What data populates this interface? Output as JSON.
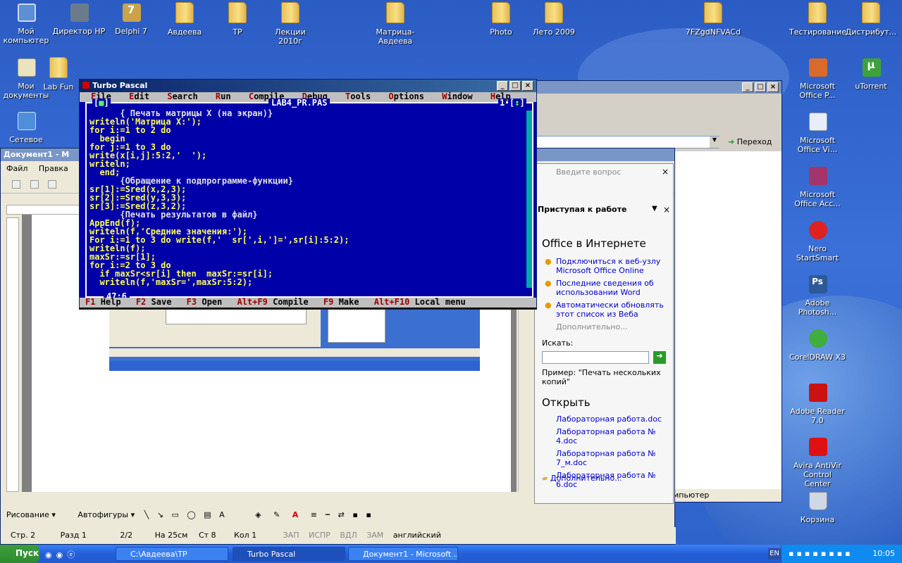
{
  "desktop_icons": [
    {
      "label": "Мой компьютер",
      "icon": "my-computer-icon"
    },
    {
      "label": "Директор HP",
      "icon": "hp-director-icon"
    },
    {
      "label": "Delphi 7",
      "icon": "delphi-icon"
    },
    {
      "label": "Авдеева",
      "icon": "folder-icon"
    },
    {
      "label": "TP",
      "icon": "folder-icon"
    },
    {
      "label": "Лекции 2010г",
      "icon": "folder-icon"
    },
    {
      "label": "Матрица-Авдеева",
      "icon": "folder-icon"
    },
    {
      "label": "Photo",
      "icon": "folder-icon"
    },
    {
      "label": "Лето 2009",
      "icon": "folder-icon"
    },
    {
      "label": "7FZgdNFVACd",
      "icon": "folder-icon"
    },
    {
      "label": "Тестирование",
      "icon": "folder-icon"
    },
    {
      "label": "Дистрибут...",
      "icon": "folder-icon"
    },
    {
      "label": "Мои документы",
      "icon": "my-documents-icon"
    },
    {
      "label": "Lab Fun",
      "icon": "folder-icon"
    },
    {
      "label": "Сетевое",
      "icon": "network-icon"
    },
    {
      "label": "Microsoft Office P...",
      "icon": "powerpoint-icon"
    },
    {
      "label": "uTorrent",
      "icon": "utorrent-icon"
    },
    {
      "label": "Microsoft Office Vi...",
      "icon": "visio-icon"
    },
    {
      "label": "Microsoft Office Acc...",
      "icon": "access-icon"
    },
    {
      "label": "Nero StartSmart",
      "icon": "nero-icon"
    },
    {
      "label": "Adobe Photosh...",
      "icon": "photoshop-icon"
    },
    {
      "label": "CorelDRAW X3",
      "icon": "coreldraw-icon"
    },
    {
      "label": "Adobe Reader 7.0",
      "icon": "adobe-reader-icon"
    },
    {
      "label": "Avira AntiVir Control Center",
      "icon": "avira-icon"
    },
    {
      "label": "Корзина",
      "icon": "recycle-bin-icon"
    }
  ],
  "tp": {
    "title": "Turbo Pascal",
    "menu": [
      {
        "hot": "F",
        "rest": "ile"
      },
      {
        "hot": "E",
        "rest": "dit"
      },
      {
        "hot": "S",
        "rest": "earch"
      },
      {
        "hot": "R",
        "rest": "un"
      },
      {
        "hot": "C",
        "rest": "ompile"
      },
      {
        "hot": "D",
        "rest": "ebug"
      },
      {
        "hot": "T",
        "rest": "ools"
      },
      {
        "hot": "O",
        "rest": "ptions"
      },
      {
        "hot": "W",
        "rest": "indow"
      },
      {
        "hot": "H",
        "rest": "elp"
      }
    ],
    "file_name": "LAB4_PR.PAS",
    "window_number": "1",
    "cursor_pos": "47:6",
    "code_lines": [
      {
        "t": "      { Печать матрицы X (на экран)}",
        "c": true
      },
      {
        "t": "writeln('Матрица X:');",
        "c": false
      },
      {
        "t": "for i:=1 to 2 do",
        "c": false
      },
      {
        "t": "  begin",
        "c": false
      },
      {
        "t": "for j:=1 to 3 do",
        "c": false
      },
      {
        "t": "write(x[i,j]:5:2,'  ');",
        "c": false
      },
      {
        "t": "writeln;",
        "c": false
      },
      {
        "t": "  end;",
        "c": false
      },
      {
        "t": "      {Обращение к подпрограмме-функции}",
        "c": true
      },
      {
        "t": "sr[1]:=Sred(x,2,3);",
        "c": false
      },
      {
        "t": "sr[2]:=Sred(y,3,3);",
        "c": false
      },
      {
        "t": "sr[3]:=Sred(z,3,2);",
        "c": false
      },
      {
        "t": "      {Печать результатов в файл}",
        "c": true
      },
      {
        "t": "AppEnd(f);",
        "c": false
      },
      {
        "t": "writeln(f,'Средние значения:');",
        "c": false
      },
      {
        "t": "For i:=1 to 3 do write(f,'  sr[',i,']=',sr[i]:5:2);",
        "c": false
      },
      {
        "t": "writeln(f);",
        "c": false
      },
      {
        "t": "maxSr:=sr[1];",
        "c": false
      },
      {
        "t": "for i:=2 to 3 do",
        "c": false
      },
      {
        "t": "  if maxSr<sr[i] then  maxSr:=sr[i];",
        "c": false
      },
      {
        "t": "  writeln(f,'maxSr=',maxSr:5:2);",
        "c": false
      }
    ],
    "status": [
      {
        "key": "F1",
        "label": "Help"
      },
      {
        "key": "F2",
        "label": "Save"
      },
      {
        "key": "F3",
        "label": "Open"
      },
      {
        "key": "Alt+F9",
        "label": "Compile"
      },
      {
        "key": "F9",
        "label": "Make"
      },
      {
        "key": "Alt+F10",
        "label": "Local menu"
      }
    ]
  },
  "explorer": {
    "go_label": "Переход",
    "status_fragment": "мпьютер"
  },
  "word": {
    "title": "Документ1 - М",
    "menu": [
      "Файл",
      "Правка"
    ],
    "drawing_label": "Рисование",
    "autoshapes_label": "Автофигуры",
    "status": [
      "Стр. 2",
      "Разд 1",
      "2/2",
      "На 25см",
      "Ст 8",
      "Кол 1",
      "ЗАП",
      "ИСПР",
      "ВДЛ",
      "ЗАМ",
      "английский"
    ]
  },
  "task_pane": {
    "question_placeholder": "Введите вопрос",
    "title": "Приступая к работе",
    "office_online_heading": "Office в Интернете",
    "links": [
      "Подключиться к веб-узлу Microsoft Office Online",
      "Последние сведения об использовании Word",
      "Автоматически обновлять этот список из Веба"
    ],
    "more": "Дополнительно...",
    "search_label": "Искать:",
    "search_example": "Пример: \"Печать нескольких копий\"",
    "open_heading": "Открыть",
    "recent_files": [
      "Лабораторная работа.doc",
      "Лабораторная работа № 4.doc",
      "Лабораторная работа № 7_м.doc",
      "Лабораторная работа № 6.doc"
    ],
    "more_files": "Дополнительно..."
  },
  "taskbar": {
    "start_label": "Пуск",
    "buttons": [
      {
        "label": "C:\\Авдеева\\TP"
      },
      {
        "label": "Turbo Pascal"
      },
      {
        "label": "Документ1 - Microsoft ..."
      }
    ],
    "lang": "EN",
    "clock": "10:05"
  }
}
